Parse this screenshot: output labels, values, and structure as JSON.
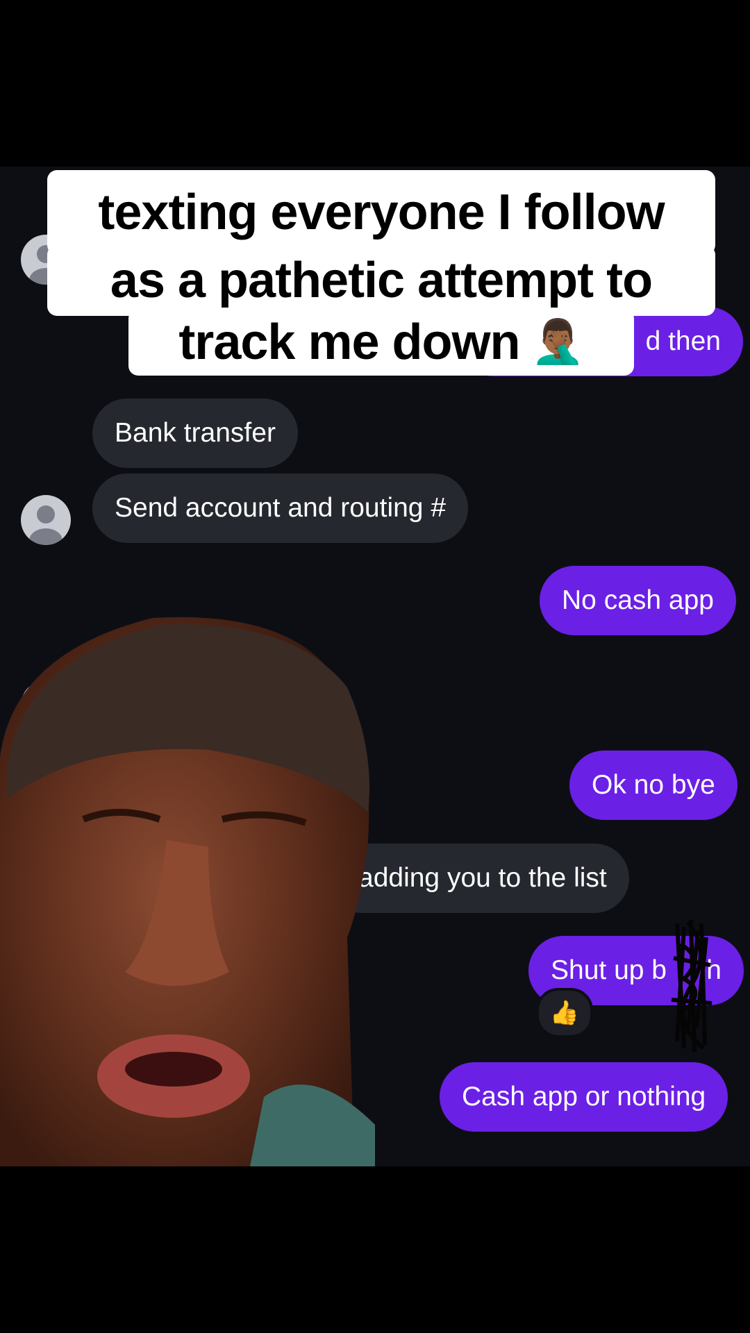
{
  "caption": {
    "line1": "texting everyone I follow",
    "line2": "as a pathetic attempt to",
    "line3": "track me down",
    "emoji": "🤦🏾‍♂️"
  },
  "messages": {
    "partial_out": "d then",
    "bank_transfer": "Bank transfer",
    "send_account": "Send account and routing #",
    "no_cash_app": "No cash app",
    "ok_no_bye": "Ok no bye",
    "adding_list": "adding you to the list",
    "shut_up": "Shut up b",
    "shut_up_tail": "h",
    "reaction": "👍",
    "cash_app_or_nothing": "Cash app or nothing"
  },
  "colors": {
    "chat_bg": "#0d0e14",
    "incoming_bubble": "#262830",
    "outgoing_bubble": "#6b20e6",
    "caption_bg": "#ffffff"
  },
  "icons": [
    "avatar-icon",
    "thumbs-up-icon",
    "facepalm-emoji"
  ]
}
